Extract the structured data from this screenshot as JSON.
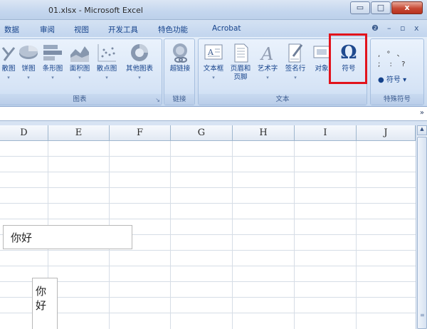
{
  "window": {
    "title": "01.xlsx - Microsoft Excel",
    "minimize": "▭",
    "maximize": "□",
    "close": "x"
  },
  "tabs": [
    "数据",
    "审阅",
    "视图",
    "开发工具",
    "特色功能",
    "Acrobat"
  ],
  "tab_right": {
    "help": "❷",
    "minimize": "–",
    "restore": "▫",
    "close": "x"
  },
  "ribbon": {
    "charts_group": {
      "label": "图表",
      "buttons": [
        "散图",
        "饼图",
        "条形图",
        "面积图",
        "散点图",
        "其他图表"
      ]
    },
    "links_group": {
      "label": "链接",
      "buttons": [
        "超链接"
      ]
    },
    "text_group": {
      "label": "文本",
      "buttons": [
        {
          "line1": "文本框",
          "line2": ""
        },
        {
          "line1": "页眉和",
          "line2": "页脚"
        },
        {
          "line1": "艺术字",
          "line2": ""
        },
        {
          "line1": "签名行",
          "line2": ""
        },
        {
          "line1": "对象",
          "line2": ""
        },
        {
          "line1": "符号",
          "line2": ""
        }
      ],
      "symbol_glyph": "Ω"
    },
    "special_group": {
      "label": "特殊符号",
      "row1": ", ° 、",
      "row2": "; : ?",
      "button": "符号"
    }
  },
  "formula_bar": {
    "expand": "»"
  },
  "columns": [
    "D",
    "E",
    "F",
    "G",
    "H",
    "I",
    "J"
  ],
  "cells": {
    "textbox_horizontal": "你好",
    "textbox_vertical_1": "你",
    "textbox_vertical_2": "好"
  },
  "colors": {
    "highlight": "#e2131c",
    "ribbon_text": "#15428b"
  }
}
